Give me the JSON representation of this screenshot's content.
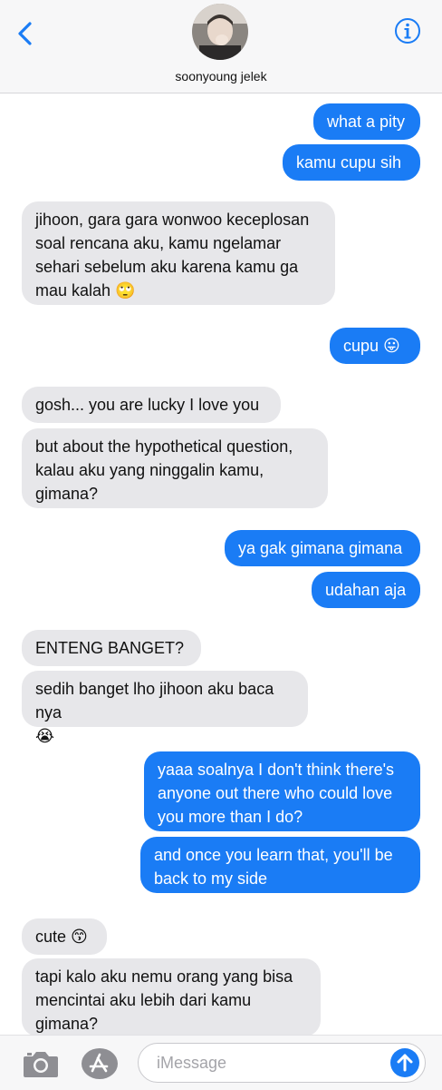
{
  "header": {
    "contact_name": "soonyoung jelek"
  },
  "messages": [
    {
      "id": "m1",
      "dir": "out",
      "text": "what a pity"
    },
    {
      "id": "m2",
      "dir": "out",
      "text": "kamu cupu sih"
    },
    {
      "id": "m3",
      "dir": "in",
      "text": "jihoon, gara gara wonwoo keceplosan\nsoal rencana aku, kamu ngelamar\nsehari sebelum aku karena kamu ga\nmau kalah 🙄"
    },
    {
      "id": "m4",
      "dir": "out",
      "text": "cupu 😛"
    },
    {
      "id": "m5",
      "dir": "in",
      "text": "gosh... you are lucky I love you"
    },
    {
      "id": "m6",
      "dir": "in",
      "text": "but about the hypothetical question,\nkalau aku yang ninggalin kamu,\ngimana?"
    },
    {
      "id": "m7",
      "dir": "out",
      "text": "ya gak gimana gimana"
    },
    {
      "id": "m8",
      "dir": "out",
      "text": "udahan aja"
    },
    {
      "id": "m9",
      "dir": "in",
      "text": "ENTENG BANGET?"
    },
    {
      "id": "m10",
      "dir": "in",
      "text": "sedih banget lho jihoon aku baca nya\n😭"
    },
    {
      "id": "m11",
      "dir": "out",
      "text": "yaaa soalnya I don't think there's\nanyone out there who could love\nyou more than I do?"
    },
    {
      "id": "m12",
      "dir": "out",
      "text": "and once you learn that, you'll be\nback to my side"
    },
    {
      "id": "m13",
      "dir": "in",
      "text": "cute 😙"
    },
    {
      "id": "m14",
      "dir": "in",
      "text": "tapi kalo aku nemu orang yang bisa\nmencintai aku lebih dari kamu\ngimana?"
    }
  ],
  "composer": {
    "placeholder": "iMessage"
  },
  "colors": {
    "outgoing_bubble": "#1a7cf5",
    "incoming_bubble": "#e7e7ea",
    "accent": "#1a7cf5"
  },
  "icons": [
    "back-chevron-icon",
    "info-icon",
    "camera-icon",
    "app-store-icon",
    "send-arrow-icon"
  ]
}
